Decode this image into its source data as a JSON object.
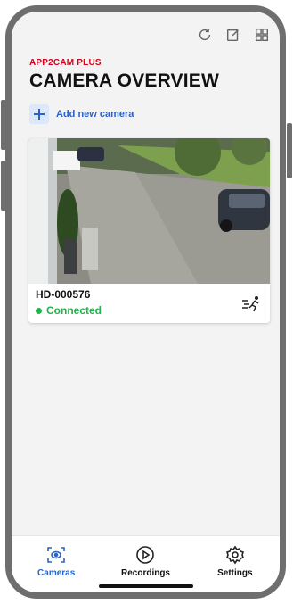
{
  "header": {
    "brand": "APP2CAM PLUS",
    "title": "CAMERA OVERVIEW",
    "icons": [
      "refresh-icon",
      "edit-icon",
      "grid-icon"
    ]
  },
  "actions": {
    "add_camera_label": "Add new camera"
  },
  "cameras": [
    {
      "name": "HD-000576",
      "status": "Connected",
      "status_color": "#21b24b",
      "motion_icon": "motion-detection-icon"
    }
  ],
  "bottom_nav": {
    "items": [
      {
        "label": "Cameras",
        "icon": "camera-icon",
        "active": true
      },
      {
        "label": "Recordings",
        "icon": "play-icon",
        "active": false
      },
      {
        "label": "Settings",
        "icon": "gear-icon",
        "active": false
      }
    ]
  },
  "colors": {
    "brand_red": "#d4001a",
    "accent_blue": "#2a62c9",
    "status_green": "#21b24b"
  }
}
